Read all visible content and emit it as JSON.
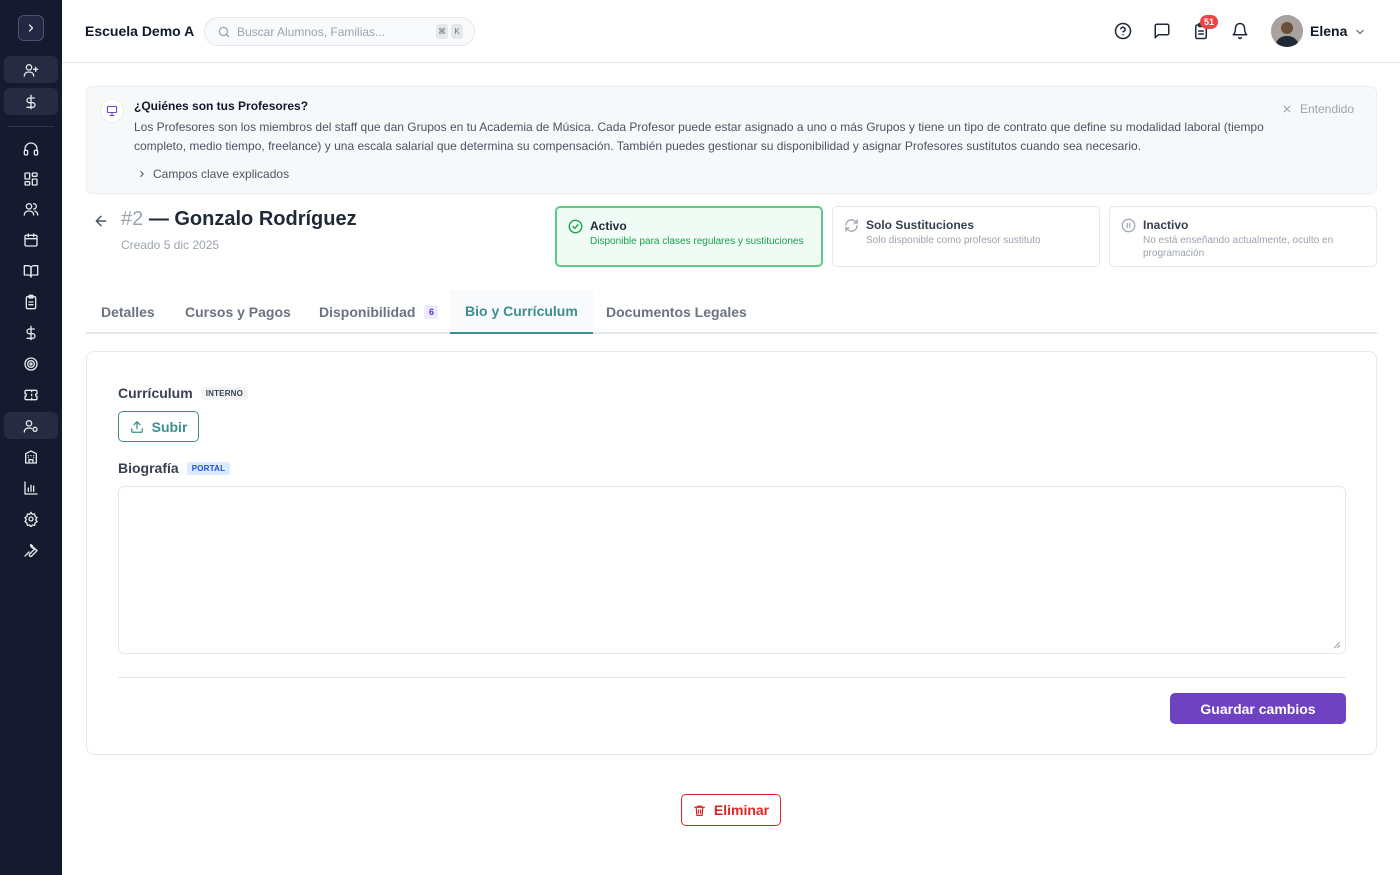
{
  "header": {
    "school_name": "Escuela Demo A",
    "search_placeholder": "Buscar Alumnos, Familias...",
    "shortcut_keys": [
      "⌘",
      "K"
    ],
    "notifications_count": "51",
    "user_name": "Elena"
  },
  "sidebar": {
    "items": [
      {
        "icon": "user-plus-icon"
      },
      {
        "icon": "dollar-icon"
      },
      {
        "icon": "headset-icon"
      },
      {
        "icon": "dashboard-grid-icon"
      },
      {
        "icon": "users-icon"
      },
      {
        "icon": "calendar-icon"
      },
      {
        "icon": "book-open-icon"
      },
      {
        "icon": "clipboard-icon"
      },
      {
        "icon": "dollar-icon"
      },
      {
        "icon": "target-icon"
      },
      {
        "icon": "ticket-icon"
      },
      {
        "icon": "user-settings-icon",
        "active": true
      },
      {
        "icon": "building-icon"
      },
      {
        "icon": "bar-chart-icon"
      },
      {
        "icon": "gear-icon"
      },
      {
        "icon": "wrench-icon"
      }
    ]
  },
  "banner": {
    "title": "¿Quiénes son tus Profesores?",
    "text": "Los Profesores son los miembros del staff que dan Grupos en tu Academia de Música. Cada Profesor puede estar asignado a uno o más Grupos y tiene un tipo de contrato que define su modalidad laboral (tiempo completo, medio tiempo, freelance) y una escala salarial que determina su compensación. También puedes gestionar su disponibilidad y asignar Profesores sustitutos cuando sea necesario.",
    "more_label": "Campos clave explicados",
    "dismiss_label": "Entendido"
  },
  "teacher": {
    "number": "#2",
    "name": "— Gonzalo Rodríguez",
    "created": "Creado 5 dic 2025"
  },
  "status_options": [
    {
      "title": "Activo",
      "description": "Disponible para clases regulares y sustituciones",
      "selected": true
    },
    {
      "title": "Solo Sustituciones",
      "description": "Solo disponible como profesor sustituto",
      "selected": false
    },
    {
      "title": "Inactivo",
      "description": "No está enseñando actualmente, oculto en programación",
      "selected": false
    }
  ],
  "tabs": [
    {
      "label": "Detalles"
    },
    {
      "label": "Cursos y Pagos"
    },
    {
      "label": "Disponibilidad",
      "badge": "6"
    },
    {
      "label": "Bio y Currículum",
      "active": true
    },
    {
      "label": "Documentos Legales"
    }
  ],
  "form": {
    "cv_label": "Currículum",
    "cv_tag": "INTERNO",
    "upload_label": "Subir",
    "bio_label": "Biografía",
    "bio_tag": "PORTAL",
    "bio_value": "",
    "save_label": "Guardar cambios"
  },
  "delete_label": "Eliminar",
  "colors": {
    "sidebar_bg": "#161a2e",
    "accent_teal": "#3d8f8f",
    "primary_purple": "#6f42c1",
    "danger": "#dc2626",
    "active_green": "#5dc98a"
  }
}
